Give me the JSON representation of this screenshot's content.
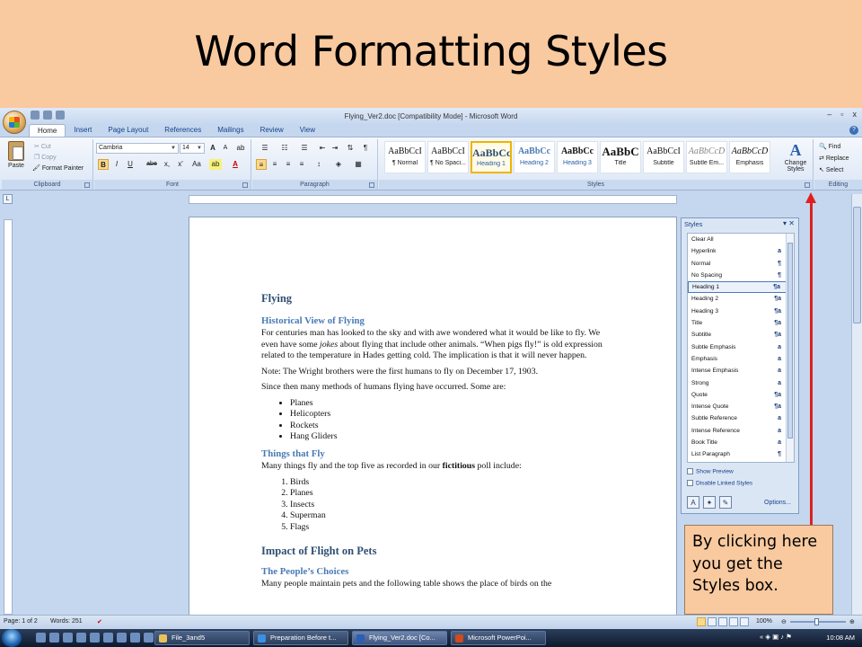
{
  "slide": {
    "title": "Word Formatting Styles"
  },
  "window": {
    "title": "Flying_Ver2.doc [Compatibility Mode] - Microsoft Word",
    "controls": [
      "–",
      "▫",
      "x"
    ]
  },
  "tabs": [
    "Home",
    "Insert",
    "Page Layout",
    "References",
    "Mailings",
    "Review",
    "View"
  ],
  "ribbon": {
    "clipboard": {
      "label": "Clipboard",
      "paste": "Paste",
      "cut": "Cut",
      "copy": "Copy",
      "format_painter": "Format Painter"
    },
    "font": {
      "label": "Font",
      "name": "Cambria",
      "size": "14",
      "grow": "A",
      "shrink": "A",
      "clear": "ab",
      "bold": "B",
      "italic": "I",
      "underline": "U",
      "strike": "abe",
      "sub": "x,",
      "sup": "x'",
      "case": "Aa",
      "highlight": "ab",
      "color": "A"
    },
    "paragraph": {
      "label": "Paragraph"
    },
    "styles": {
      "label": "Styles",
      "items": [
        {
          "sample": "AaBbCcI",
          "name": "¶ Normal"
        },
        {
          "sample": "AaBbCcI",
          "name": "¶ No Spaci..."
        },
        {
          "sample": "AaBbCc",
          "name": "Heading 1"
        },
        {
          "sample": "AaBbCc",
          "name": "Heading 2"
        },
        {
          "sample": "AaBbCc",
          "name": "Heading 3"
        },
        {
          "sample": "AaBbC",
          "name": "Title"
        },
        {
          "sample": "AaBbCcI",
          "name": "Subtitle"
        },
        {
          "sample": "AaBbCcD",
          "name": "Subtle Em..."
        },
        {
          "sample": "AaBbCcD",
          "name": "Emphasis"
        }
      ],
      "change": "Change Styles"
    },
    "editing": {
      "label": "Editing",
      "find": "Find",
      "replace": "Replace",
      "select": "Select"
    }
  },
  "document": {
    "h_flying": "Flying",
    "h_historical": "Historical View of Flying",
    "p1_a": "For centuries man has looked to the sky and with awe wondered what it would be like to fly.  We even have some ",
    "p1_em": "jokes",
    "p1_b": " about flying that include other animals.  “When pigs fly!” is old expression related to the temperature in Hades getting cold.  The implication is that it will never happen.",
    "p2": "Note: The Wright brothers were the first humans to fly on December 17, 1903.",
    "p3": "Since then many methods of humans flying have occurred.  Some are:",
    "bullets": [
      "Planes",
      "Helicopters",
      "Rockets",
      "Hang Gliders"
    ],
    "h_things": "Things that Fly",
    "p4_a": "Many things fly and the top five as recorded in our ",
    "p4_strong": "fictitious",
    "p4_b": " poll include:",
    "numbered": [
      "Birds",
      "Planes",
      "Insects",
      "Superman",
      "Flags"
    ],
    "h_impact": "Impact of Flight on Pets",
    "h_people": "The People’s Choices",
    "p5": "Many people maintain pets and the following table shows the place of birds on the"
  },
  "styles_pane": {
    "title": "Styles",
    "items": [
      {
        "name": "Clear All",
        "mark": ""
      },
      {
        "name": "Hyperlink",
        "mark": "a"
      },
      {
        "name": "Normal",
        "mark": "¶"
      },
      {
        "name": "No Spacing",
        "mark": "¶"
      },
      {
        "name": "Heading 1",
        "mark": "¶a"
      },
      {
        "name": "Heading 2",
        "mark": "¶a"
      },
      {
        "name": "Heading 3",
        "mark": "¶a"
      },
      {
        "name": "Title",
        "mark": "¶a"
      },
      {
        "name": "Subtitle",
        "mark": "¶a"
      },
      {
        "name": "Subtle Emphasis",
        "mark": "a"
      },
      {
        "name": "Emphasis",
        "mark": "a"
      },
      {
        "name": "Intense Emphasis",
        "mark": "a"
      },
      {
        "name": "Strong",
        "mark": "a"
      },
      {
        "name": "Quote",
        "mark": "¶a"
      },
      {
        "name": "Intense Quote",
        "mark": "¶a"
      },
      {
        "name": "Subtle Reference",
        "mark": "a"
      },
      {
        "name": "Intense Reference",
        "mark": "a"
      },
      {
        "name": "Book Title",
        "mark": "a"
      },
      {
        "name": "List Paragraph",
        "mark": "¶"
      }
    ],
    "show_preview": "Show Preview",
    "disable_linked": "Disable Linked Styles",
    "options": "Options..."
  },
  "callout": {
    "text": "By clicking here you get the Styles box."
  },
  "status": {
    "page": "Page: 1 of 2",
    "words": "Words: 251",
    "zoom": "100%"
  },
  "taskbar": {
    "tasks": [
      "File_3and5",
      "Preparation Before t...",
      "Flying_Ver2.doc [Co...",
      "Microsoft PowerPoi..."
    ],
    "time": "10:08 AM"
  }
}
